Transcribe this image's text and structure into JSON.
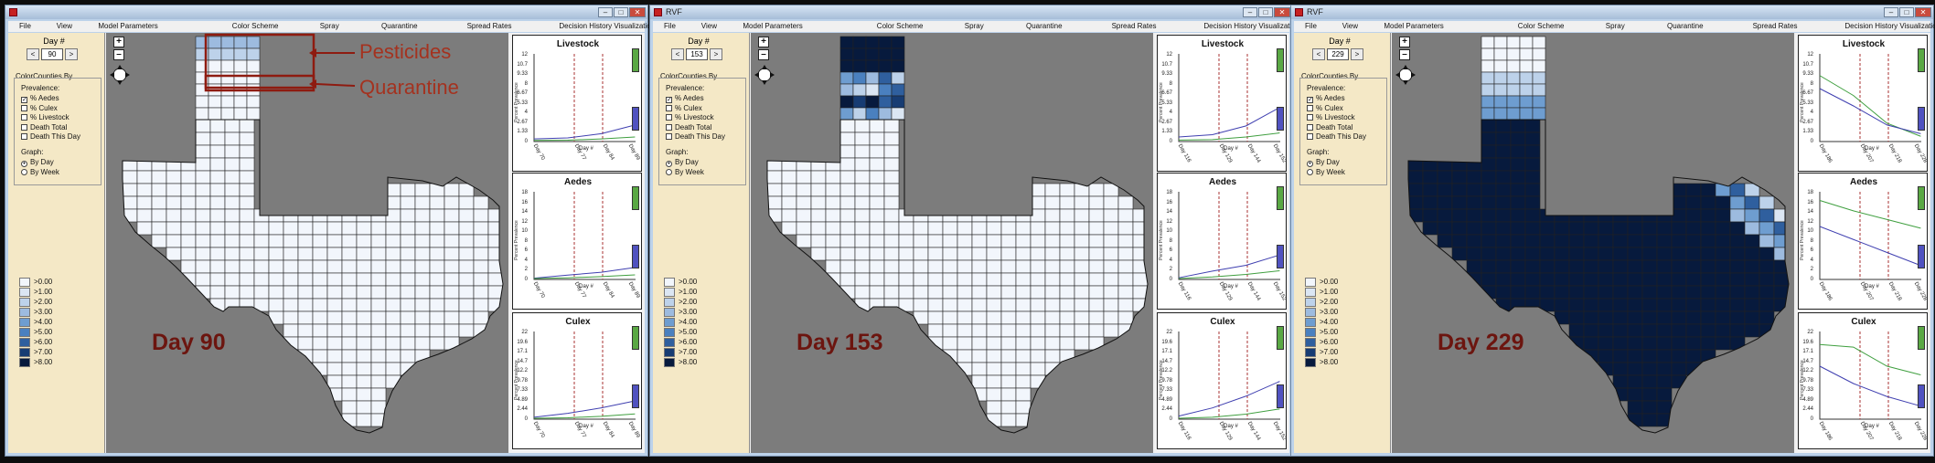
{
  "menu": [
    "File",
    "View",
    "Model Parameters",
    "Color Scheme",
    "Spray",
    "Quarantine",
    "Spread Rates",
    "Decision History Visualization/Navigation"
  ],
  "sidebar": {
    "day_label": "Day #",
    "prev": "<",
    "next": ">",
    "color_counties_by": "ColorCounties By",
    "prevalence": "Prevalence:",
    "checks": [
      "% Aedes",
      "% Culex",
      "% Livestock",
      "Death Total",
      "Death This Day"
    ],
    "graph": "Graph:",
    "graph_opts": [
      "By Day",
      "By Week"
    ],
    "legend": [
      ">0.00",
      ">1.00",
      ">2.00",
      ">3.00",
      ">4.00",
      ">5.00",
      ">6.00",
      ">7.00",
      ">8.00"
    ],
    "legend_colors": [
      "#f2f6fc",
      "#dbe6f3",
      "#bdd2ea",
      "#9dbbdf",
      "#6e9dd0",
      "#4a80bf",
      "#2f5f9e",
      "#173c73",
      "#071a3d"
    ]
  },
  "annotations": {
    "pesticides": "Pesticides",
    "quarantine": "Quarantine"
  },
  "charts_titles": [
    "Livestock",
    "Aedes",
    "Culex"
  ],
  "chart_axis": {
    "xlabel": "Day #",
    "ylabel": "Percent Prevalence"
  },
  "panels": [
    {
      "title": "",
      "day": "90",
      "day_label": "Day 90",
      "charts": [
        {
          "title": "Livestock",
          "yticks": [
            "12",
            "10.7",
            "9.33",
            "8",
            "6.67",
            "5.33",
            "4",
            "2.67",
            "1.33",
            "0"
          ],
          "xticks": [
            "Day 70",
            "Day 77",
            "Day 84",
            "Day 89"
          ]
        },
        {
          "title": "Aedes",
          "yticks": [
            "18",
            "16",
            "14",
            "12",
            "10",
            "8",
            "6",
            "4",
            "2",
            "0"
          ],
          "xticks": [
            "Day 70",
            "Day 77",
            "Day 84",
            "Day 89"
          ]
        },
        {
          "title": "Culex",
          "yticks": [
            "22",
            "19.6",
            "17.1",
            "14.7",
            "12.2",
            "9.78",
            "7.33",
            "4.89",
            "2.44",
            "0"
          ],
          "xticks": [
            "Day 70",
            "Day 77",
            "Day 84",
            "Day 89"
          ]
        }
      ]
    },
    {
      "title": "RVF",
      "day": "153",
      "day_label": "Day 153",
      "charts": [
        {
          "title": "Livestock",
          "yticks": [
            "12",
            "10.7",
            "9.33",
            "8",
            "6.67",
            "5.33",
            "4",
            "2.67",
            "1.33",
            "0"
          ],
          "xticks": [
            "Day 116",
            "Day 129",
            "Day 144",
            "Day 152"
          ]
        },
        {
          "title": "Aedes",
          "yticks": [
            "18",
            "16",
            "14",
            "12",
            "10",
            "8",
            "6",
            "4",
            "2",
            "0"
          ],
          "xticks": [
            "Day 116",
            "Day 129",
            "Day 144",
            "Day 152"
          ]
        },
        {
          "title": "Culex",
          "yticks": [
            "22",
            "19.6",
            "17.1",
            "14.7",
            "12.2",
            "9.78",
            "7.33",
            "4.89",
            "2.44",
            "0"
          ],
          "xticks": [
            "Day 116",
            "Day 129",
            "Day 144",
            "Day 152"
          ]
        }
      ]
    },
    {
      "title": "RVF",
      "day": "229",
      "day_label": "Day 229",
      "charts": [
        {
          "title": "Livestock",
          "yticks": [
            "12",
            "10.7",
            "9.33",
            "8",
            "6.67",
            "5.33",
            "4",
            "2.67",
            "1.33",
            "0"
          ],
          "xticks": [
            "Day 186",
            "Day 207",
            "Day 218",
            "Day 228"
          ]
        },
        {
          "title": "Aedes",
          "yticks": [
            "18",
            "16",
            "14",
            "12",
            "10",
            "8",
            "6",
            "4",
            "2",
            "0"
          ],
          "xticks": [
            "Day 186",
            "Day 207",
            "Day 218",
            "Day 228"
          ]
        },
        {
          "title": "Culex",
          "yticks": [
            "22",
            "19.6",
            "17.1",
            "14.7",
            "12.2",
            "9.78",
            "7.33",
            "4.89",
            "2.44",
            "0"
          ],
          "xticks": [
            "Day 186",
            "Day 207",
            "Day 218",
            "Day 228"
          ]
        }
      ]
    }
  ]
}
